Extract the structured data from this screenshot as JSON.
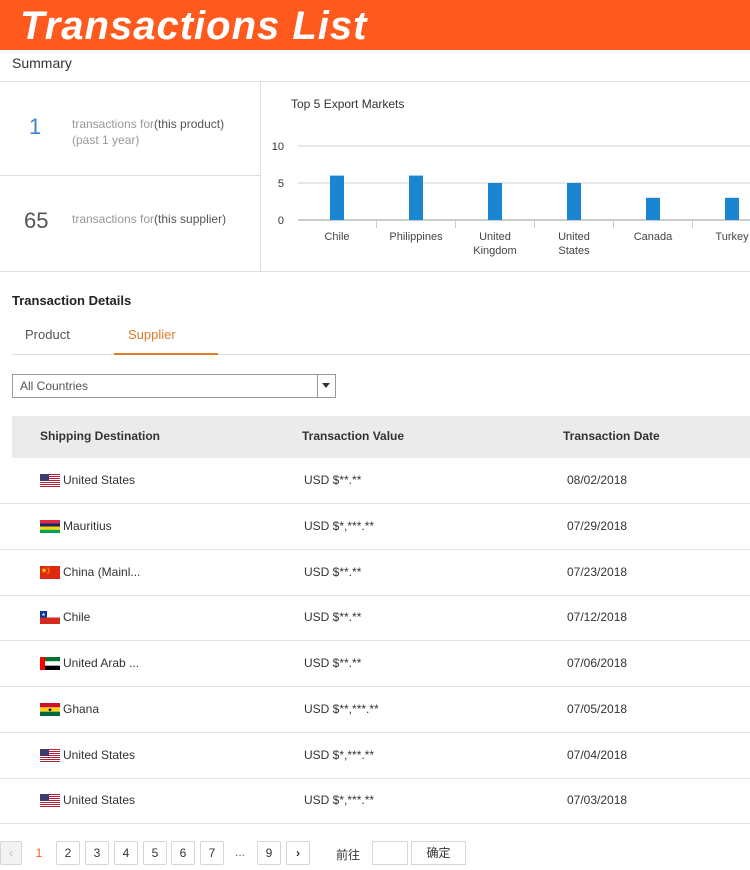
{
  "banner": {
    "title": "Transactions List"
  },
  "summary": {
    "title": "Summary",
    "stats": [
      {
        "value": "1",
        "prefix": "transactions for",
        "subject": "(this product)",
        "note": "(past 1 year)",
        "color": "#3a86c8"
      },
      {
        "value": "65",
        "prefix": "transactions for",
        "subject": "(this supplier)",
        "note": "",
        "color": "#555555"
      }
    ]
  },
  "chart_data": {
    "type": "bar",
    "title": "Top 5 Export Markets",
    "categories": [
      "Chile",
      "Philippines",
      "United Kingdom",
      "United States",
      "Canada",
      "Turkey"
    ],
    "category_lines": [
      [
        "Chile"
      ],
      [
        "Philippines"
      ],
      [
        "United",
        "Kingdom"
      ],
      [
        "United",
        "States"
      ],
      [
        "Canada"
      ],
      [
        "Turkey"
      ]
    ],
    "values": [
      6,
      6,
      5,
      5,
      3,
      3
    ],
    "ylim": [
      0,
      10
    ],
    "yticks": [
      0,
      5,
      10
    ],
    "color": "#1a85d0",
    "grid": true
  },
  "details": {
    "title": "Transaction Details",
    "tabs": [
      {
        "label": "Product",
        "active": false
      },
      {
        "label": "Supplier",
        "active": true
      }
    ],
    "filter": {
      "value": "All Countries"
    },
    "columns": [
      "Shipping Destination",
      "Transaction Value",
      "Transaction Date"
    ],
    "rows": [
      {
        "flag": "us-flag-icon",
        "destination": "United States",
        "value": "USD $**.**",
        "date": "08/02/2018"
      },
      {
        "flag": "mauritius-flag-icon",
        "destination": "Mauritius",
        "value": "USD $*,***.**",
        "date": "07/29/2018"
      },
      {
        "flag": "china-flag-icon",
        "destination": "China (Mainl...",
        "value": "USD $**.**",
        "date": "07/23/2018"
      },
      {
        "flag": "chile-flag-icon",
        "destination": "Chile",
        "value": "USD $**.**",
        "date": "07/12/2018"
      },
      {
        "flag": "uae-flag-icon",
        "destination": "United Arab ...",
        "value": "USD $**.**",
        "date": "07/06/2018"
      },
      {
        "flag": "ghana-flag-icon",
        "destination": "Ghana",
        "value": "USD $**,***.**",
        "date": "07/05/2018"
      },
      {
        "flag": "us-flag-icon",
        "destination": "United States",
        "value": "USD $*,***.**",
        "date": "07/04/2018"
      },
      {
        "flag": "us-flag-icon",
        "destination": "United States",
        "value": "USD $*,***.**",
        "date": "07/03/2018"
      }
    ]
  },
  "pagination": {
    "prev": "‹",
    "pages": [
      "1",
      "2",
      "3",
      "4",
      "5",
      "6",
      "7"
    ],
    "ellipsis": "...",
    "last": "9",
    "next": "›",
    "current": "1",
    "goto_label": "前往",
    "confirm_label": "确定"
  },
  "colors": {
    "accent": "#ff5a1e",
    "tab_active": "#e07b2a",
    "bar": "#1a85d0"
  }
}
